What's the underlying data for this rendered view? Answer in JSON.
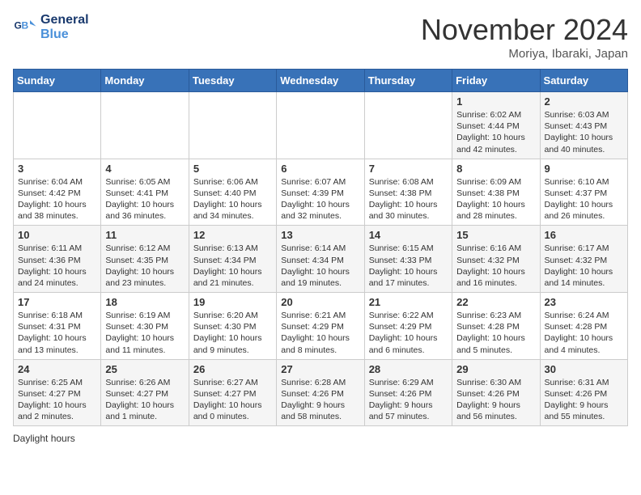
{
  "header": {
    "logo_line1": "General",
    "logo_line2": "Blue",
    "month": "November 2024",
    "location": "Moriya, Ibaraki, Japan"
  },
  "days_of_week": [
    "Sunday",
    "Monday",
    "Tuesday",
    "Wednesday",
    "Thursday",
    "Friday",
    "Saturday"
  ],
  "weeks": [
    [
      {
        "day": "",
        "info": ""
      },
      {
        "day": "",
        "info": ""
      },
      {
        "day": "",
        "info": ""
      },
      {
        "day": "",
        "info": ""
      },
      {
        "day": "",
        "info": ""
      },
      {
        "day": "1",
        "info": "Sunrise: 6:02 AM\nSunset: 4:44 PM\nDaylight: 10 hours and 42 minutes."
      },
      {
        "day": "2",
        "info": "Sunrise: 6:03 AM\nSunset: 4:43 PM\nDaylight: 10 hours and 40 minutes."
      }
    ],
    [
      {
        "day": "3",
        "info": "Sunrise: 6:04 AM\nSunset: 4:42 PM\nDaylight: 10 hours and 38 minutes."
      },
      {
        "day": "4",
        "info": "Sunrise: 6:05 AM\nSunset: 4:41 PM\nDaylight: 10 hours and 36 minutes."
      },
      {
        "day": "5",
        "info": "Sunrise: 6:06 AM\nSunset: 4:40 PM\nDaylight: 10 hours and 34 minutes."
      },
      {
        "day": "6",
        "info": "Sunrise: 6:07 AM\nSunset: 4:39 PM\nDaylight: 10 hours and 32 minutes."
      },
      {
        "day": "7",
        "info": "Sunrise: 6:08 AM\nSunset: 4:38 PM\nDaylight: 10 hours and 30 minutes."
      },
      {
        "day": "8",
        "info": "Sunrise: 6:09 AM\nSunset: 4:38 PM\nDaylight: 10 hours and 28 minutes."
      },
      {
        "day": "9",
        "info": "Sunrise: 6:10 AM\nSunset: 4:37 PM\nDaylight: 10 hours and 26 minutes."
      }
    ],
    [
      {
        "day": "10",
        "info": "Sunrise: 6:11 AM\nSunset: 4:36 PM\nDaylight: 10 hours and 24 minutes."
      },
      {
        "day": "11",
        "info": "Sunrise: 6:12 AM\nSunset: 4:35 PM\nDaylight: 10 hours and 23 minutes."
      },
      {
        "day": "12",
        "info": "Sunrise: 6:13 AM\nSunset: 4:34 PM\nDaylight: 10 hours and 21 minutes."
      },
      {
        "day": "13",
        "info": "Sunrise: 6:14 AM\nSunset: 4:34 PM\nDaylight: 10 hours and 19 minutes."
      },
      {
        "day": "14",
        "info": "Sunrise: 6:15 AM\nSunset: 4:33 PM\nDaylight: 10 hours and 17 minutes."
      },
      {
        "day": "15",
        "info": "Sunrise: 6:16 AM\nSunset: 4:32 PM\nDaylight: 10 hours and 16 minutes."
      },
      {
        "day": "16",
        "info": "Sunrise: 6:17 AM\nSunset: 4:32 PM\nDaylight: 10 hours and 14 minutes."
      }
    ],
    [
      {
        "day": "17",
        "info": "Sunrise: 6:18 AM\nSunset: 4:31 PM\nDaylight: 10 hours and 13 minutes."
      },
      {
        "day": "18",
        "info": "Sunrise: 6:19 AM\nSunset: 4:30 PM\nDaylight: 10 hours and 11 minutes."
      },
      {
        "day": "19",
        "info": "Sunrise: 6:20 AM\nSunset: 4:30 PM\nDaylight: 10 hours and 9 minutes."
      },
      {
        "day": "20",
        "info": "Sunrise: 6:21 AM\nSunset: 4:29 PM\nDaylight: 10 hours and 8 minutes."
      },
      {
        "day": "21",
        "info": "Sunrise: 6:22 AM\nSunset: 4:29 PM\nDaylight: 10 hours and 6 minutes."
      },
      {
        "day": "22",
        "info": "Sunrise: 6:23 AM\nSunset: 4:28 PM\nDaylight: 10 hours and 5 minutes."
      },
      {
        "day": "23",
        "info": "Sunrise: 6:24 AM\nSunset: 4:28 PM\nDaylight: 10 hours and 4 minutes."
      }
    ],
    [
      {
        "day": "24",
        "info": "Sunrise: 6:25 AM\nSunset: 4:27 PM\nDaylight: 10 hours and 2 minutes."
      },
      {
        "day": "25",
        "info": "Sunrise: 6:26 AM\nSunset: 4:27 PM\nDaylight: 10 hours and 1 minute."
      },
      {
        "day": "26",
        "info": "Sunrise: 6:27 AM\nSunset: 4:27 PM\nDaylight: 10 hours and 0 minutes."
      },
      {
        "day": "27",
        "info": "Sunrise: 6:28 AM\nSunset: 4:26 PM\nDaylight: 9 hours and 58 minutes."
      },
      {
        "day": "28",
        "info": "Sunrise: 6:29 AM\nSunset: 4:26 PM\nDaylight: 9 hours and 57 minutes."
      },
      {
        "day": "29",
        "info": "Sunrise: 6:30 AM\nSunset: 4:26 PM\nDaylight: 9 hours and 56 minutes."
      },
      {
        "day": "30",
        "info": "Sunrise: 6:31 AM\nSunset: 4:26 PM\nDaylight: 9 hours and 55 minutes."
      }
    ]
  ],
  "footer": {
    "daylight_label": "Daylight hours"
  }
}
